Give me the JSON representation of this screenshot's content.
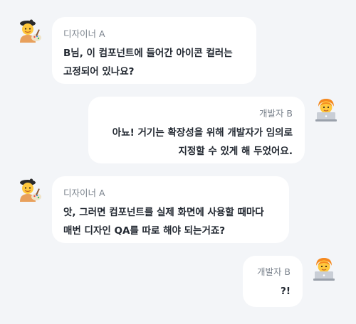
{
  "messages": [
    {
      "sender": "디자이너 A",
      "side": "left",
      "text": "B님, 이 컴포넌트에 들어간 아이콘 컬러는\n고정되어 있나요?",
      "avatar_icon": "artist-icon"
    },
    {
      "sender": "개발자 B",
      "side": "right",
      "text": "아뇨! 거기는 확장성을 위해 개발자가 임의로\n지정할 수 있게 해 두었어요.",
      "avatar_icon": "developer-laptop-icon"
    },
    {
      "sender": "디자이너 A",
      "side": "left",
      "text": "앗, 그러면 컴포넌트를 실제 화면에 사용할 때마다\n매번 디자인 QA를 따로 해야 되는거죠?",
      "avatar_icon": "artist-icon"
    },
    {
      "sender": "개발자 B",
      "side": "right",
      "text": "?!",
      "avatar_icon": "developer-laptop-icon"
    }
  ],
  "colors": {
    "background": "#f3f5f8",
    "bubble": "#ffffff",
    "sender_name": "#7b838d",
    "message_text": "#222831"
  }
}
